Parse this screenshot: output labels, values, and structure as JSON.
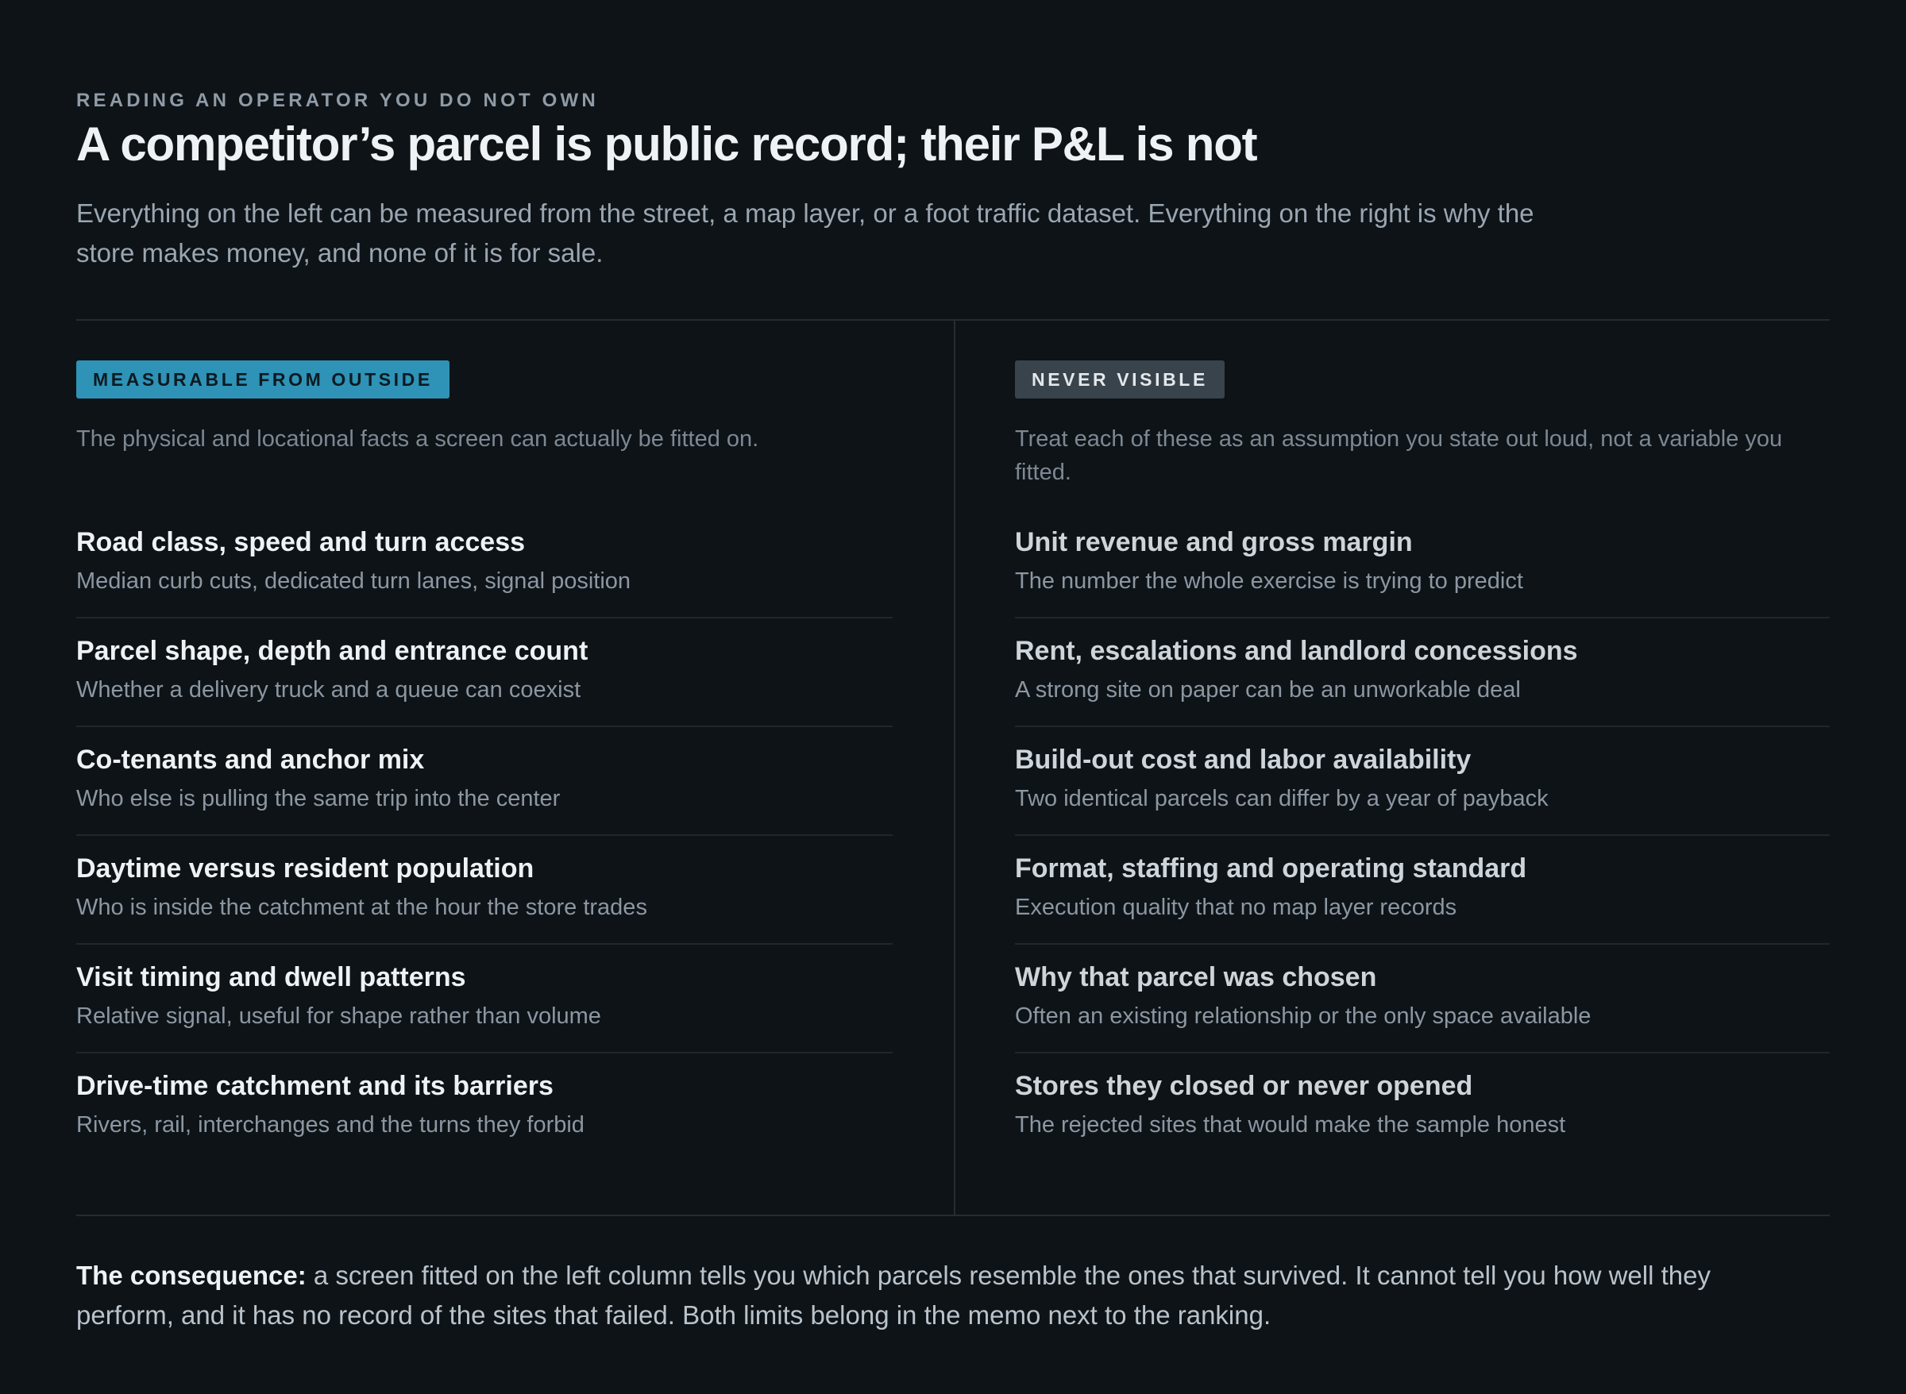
{
  "header": {
    "eyebrow": "READING AN OPERATOR YOU DO NOT OWN",
    "title": "A competitor’s parcel is public record; their P&L is not",
    "lede": "Everything on the left can be measured from the street, a map layer, or a foot traffic dataset. Everything on the right is why the store makes money, and none of it is for sale."
  },
  "columns": {
    "left": {
      "tag": "MEASURABLE FROM OUTSIDE",
      "description": "The physical and locational facts a screen can actually be fitted on.",
      "items": [
        {
          "title": "Road class, speed and turn access",
          "subtitle": "Median curb cuts, dedicated turn lanes, signal position"
        },
        {
          "title": "Parcel shape, depth and entrance count",
          "subtitle": "Whether a delivery truck and a queue can coexist"
        },
        {
          "title": "Co-tenants and anchor mix",
          "subtitle": "Who else is pulling the same trip into the center"
        },
        {
          "title": "Daytime versus resident population",
          "subtitle": "Who is inside the catchment at the hour the store trades"
        },
        {
          "title": "Visit timing and dwell patterns",
          "subtitle": "Relative signal, useful for shape rather than volume"
        },
        {
          "title": "Drive-time catchment and its barriers",
          "subtitle": "Rivers, rail, interchanges and the turns they forbid"
        }
      ]
    },
    "right": {
      "tag": "NEVER VISIBLE",
      "description": "Treat each of these as an assumption you state out loud, not a variable you fitted.",
      "items": [
        {
          "title": "Unit revenue and gross margin",
          "subtitle": "The number the whole exercise is trying to predict"
        },
        {
          "title": "Rent, escalations and landlord concessions",
          "subtitle": "A strong site on paper can be an unworkable deal"
        },
        {
          "title": "Build-out cost and labor availability",
          "subtitle": "Two identical parcels can differ by a year of payback"
        },
        {
          "title": "Format, staffing and operating standard",
          "subtitle": "Execution quality that no map layer records"
        },
        {
          "title": "Why that parcel was chosen",
          "subtitle": "Often an existing relationship or the only space available"
        },
        {
          "title": "Stores they closed or never opened",
          "subtitle": "The rejected sites that would make the sample honest"
        }
      ]
    }
  },
  "footer": {
    "lead": "The consequence:",
    "text": " a screen fitted on the left column tells you which parcels resemble the ones that survived. It cannot tell you how well they perform, and it has no record of the sites that failed. Both limits belong in the memo next to the ranking."
  },
  "colors": {
    "background": "#0e1317",
    "measurable_tag": "#2e93b6",
    "never_tag": "#39434c",
    "divider": "#242c33"
  }
}
